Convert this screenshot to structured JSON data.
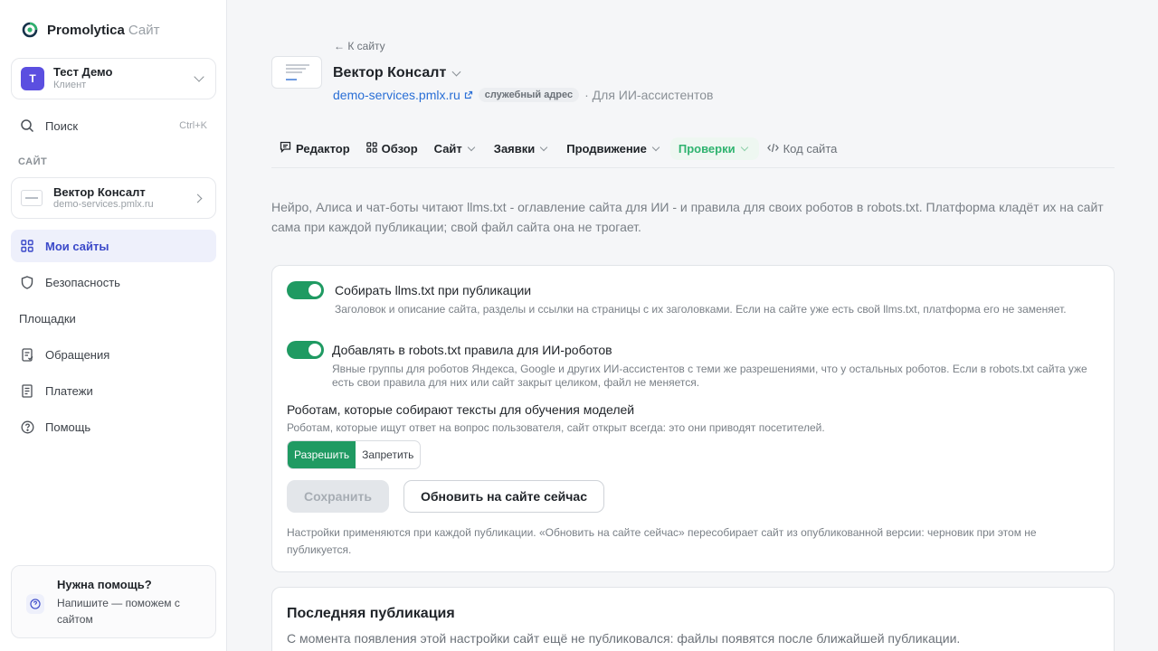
{
  "brand": {
    "name": "Promolytica",
    "suffix": "Сайт"
  },
  "account": {
    "initial": "Т",
    "name": "Тест Демо",
    "role": "Клиент"
  },
  "search": {
    "label": "Поиск",
    "shortcut": "Ctrl+K"
  },
  "sidebar": {
    "section_label": "САЙТ",
    "site": {
      "name": "Вектор Консалт",
      "url": "demo-services.pmlx.ru"
    },
    "items": [
      {
        "label": "Мои сайты",
        "icon": "grid-icon",
        "active": true
      },
      {
        "label": "Безопасность",
        "icon": "shield-icon",
        "active": false
      },
      {
        "label": "Площадки",
        "icon": "",
        "active": false
      },
      {
        "label": "Обращения",
        "icon": "document-icon",
        "active": false
      },
      {
        "label": "Платежи",
        "icon": "receipt-icon",
        "active": false
      },
      {
        "label": "Помощь",
        "icon": "help-circle-icon",
        "active": false
      }
    ],
    "help": {
      "title": "Нужна помощь?",
      "text": "Напишите — поможем с сайтом"
    }
  },
  "header": {
    "back": "К сайту",
    "title": "Вектор Консалт",
    "url": "demo-services.pmlx.ru",
    "badge": "служебный адрес",
    "suffix": "· Для ИИ-ассистентов"
  },
  "tabs": [
    {
      "label": "Редактор",
      "icon": "message-square-icon"
    },
    {
      "label": "Обзор",
      "icon": "grid-icon"
    },
    {
      "label": "Сайт",
      "chevron": true
    },
    {
      "label": "Заявки",
      "chevron": true
    },
    {
      "label": "Продвижение",
      "chevron": true
    },
    {
      "label": "Проверки",
      "chevron": true,
      "active": true
    },
    {
      "label": "Код сайта",
      "icon": "code-icon",
      "plain": true
    }
  ],
  "intro": "Нейро, Алиса и чат-боты читают llms.txt - оглавление сайта для ИИ - и правила для своих роботов в robots.txt. Платформа кладёт их на сайт сама при каждой публикации; свой файл сайта она не трогает.",
  "settings": {
    "option1": {
      "title": "Собирать llms.txt при публикации",
      "desc": "Заголовок и описание сайта, разделы и ссылки на страницы с их заголовками. Если на сайте уже есть свой llms.txt, платформа его не заменяет.",
      "enabled": true
    },
    "option2": {
      "title": "Добавлять в robots.txt правила для ИИ-роботов",
      "desc": "Явные группы для роботов Яндекса, Google и других ИИ-ассистентов с теми же разрешениями, что у остальных роботов. Если в robots.txt сайта уже есть свои правила для них или сайт закрыт целиком, файл не меняется.",
      "enabled": true
    },
    "robots_title": "Роботам, которые собирают тексты для обучения моделей",
    "robots_desc": "Роботам, которые ищут ответ на вопрос пользователя, сайт открыт всегда: это они приводят посетителей.",
    "segment": {
      "allow": "Разрешить",
      "deny": "Запретить",
      "selected": "Разрешить"
    },
    "save_label": "Сохранить",
    "update_label": "Обновить на сайте сейчас",
    "note": "Настройки применяются при каждой публикации. «Обновить на сайте сейчас» пересобирает сайт из опубликованной версии: черновик при этом не публикуется."
  },
  "last_publication": {
    "title": "Последняя публикация",
    "text": "С момента появления этой настройки сайт ещё не публиковался: файлы появятся после ближайшей публикации."
  },
  "colors": {
    "accent_green": "#1f9a62",
    "link_blue": "#2a6fd6",
    "active_nav": "#3b49c9",
    "avatar": "#5b4fe0"
  }
}
